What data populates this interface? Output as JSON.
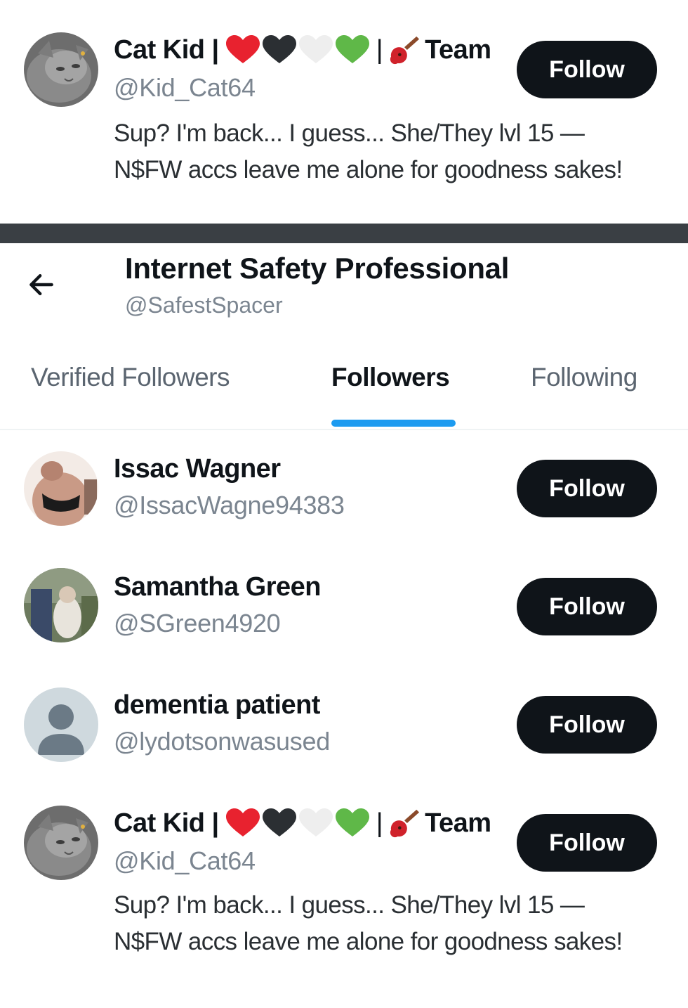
{
  "pinned_user": {
    "name_prefix": "Cat Kid |",
    "name_separator": "|",
    "name_suffix": "Team",
    "handle": "@Kid_Cat64",
    "bio": "Sup? I'm back... I guess... She/They lvl 15 — N$FW accs leave me alone for goodness sakes!",
    "follow_label": "Follow",
    "name_emojis": [
      "red-heart-icon",
      "black-heart-icon",
      "white-heart-icon",
      "green-heart-icon"
    ],
    "team_icon": "guitar-icon"
  },
  "profile_header": {
    "title": "Internet Safety Professional",
    "handle": "@SafestSpacer"
  },
  "tabs": [
    {
      "label": "Verified Followers",
      "active": false
    },
    {
      "label": "Followers",
      "active": true
    },
    {
      "label": "Following",
      "active": false
    }
  ],
  "followers": [
    {
      "name": "Issac Wagner",
      "handle": "@IssacWagne94383",
      "follow_label": "Follow",
      "avatar": "photo-avatar"
    },
    {
      "name": "Samantha Green",
      "handle": "@SGreen4920",
      "follow_label": "Follow",
      "avatar": "photo-avatar"
    },
    {
      "name": "dementia patient",
      "handle": "@lydotsonwasused",
      "follow_label": "Follow",
      "avatar": "default-avatar"
    },
    {
      "name_prefix": "Cat Kid |",
      "name_separator": "|",
      "name_suffix": "Team",
      "handle": "@Kid_Cat64",
      "bio": "Sup? I'm back... I guess... She/They lvl 15 — N$FW accs leave me alone for goodness sakes!",
      "follow_label": "Follow",
      "avatar": "cat-avatar"
    }
  ],
  "colors": {
    "follow_button_bg": "#0f1419",
    "tab_indicator": "#1d9bf0",
    "divider_bar": "#3a3f44",
    "handle_text": "#7b8590"
  },
  "icons": {
    "back": "arrow-left-icon"
  }
}
